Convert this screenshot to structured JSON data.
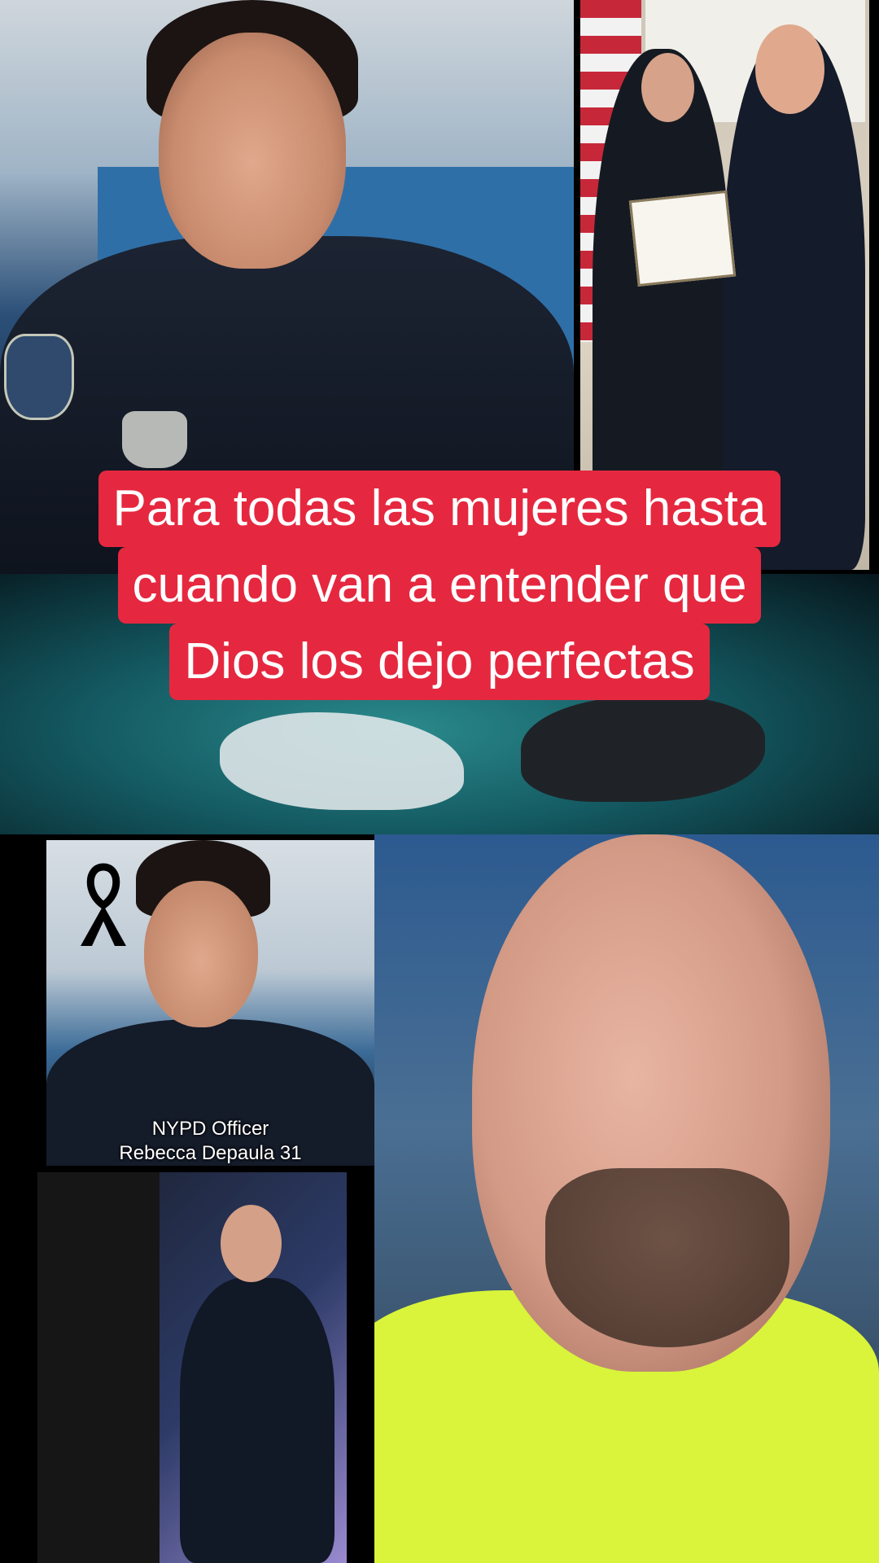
{
  "overlay_caption": {
    "lines": [
      "Para todas las mujeres hasta",
      "cuando van a entender que",
      "Dios los dejo perfectas"
    ],
    "background_color": "#e5283f",
    "text_color": "#ffffff"
  },
  "memorial_photo": {
    "caption_line1": "NYPD Officer",
    "caption_line2": "Rebecca Depaula 31"
  },
  "photos": {
    "top_left": "officer-portrait",
    "top_right": "award-ceremony",
    "middle": "surgery-scene",
    "memorial": "officer-memorial",
    "bottom_left": "officer-speaking",
    "right": "man-face"
  }
}
